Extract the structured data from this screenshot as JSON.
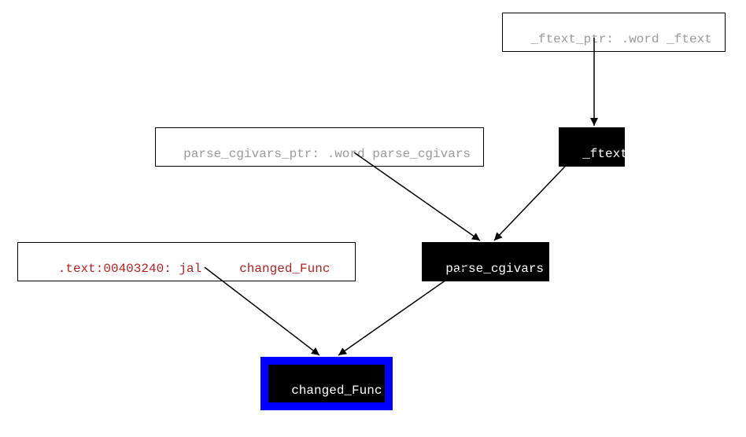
{
  "nodes": {
    "ftext_ptr": {
      "label": "_ftext_ptr: .word _ftext"
    },
    "parse_cgivars_ptr": {
      "label": "parse_cgivars_ptr: .word parse_cgivars"
    },
    "ftext": {
      "label": "_ftext"
    },
    "jal": {
      "label": ".text:00403240: jal     changed_Func"
    },
    "parse_cgivars": {
      "label": "parse_cgivars"
    },
    "changed_func": {
      "label": "changed_Func"
    }
  },
  "edges": [
    {
      "from": "ftext_ptr",
      "to": "ftext"
    },
    {
      "from": "parse_cgivars_ptr",
      "to": "parse_cgivars"
    },
    {
      "from": "ftext",
      "to": "parse_cgivars"
    },
    {
      "from": "jal",
      "to": "changed_func"
    },
    {
      "from": "parse_cgivars",
      "to": "changed_func"
    }
  ]
}
